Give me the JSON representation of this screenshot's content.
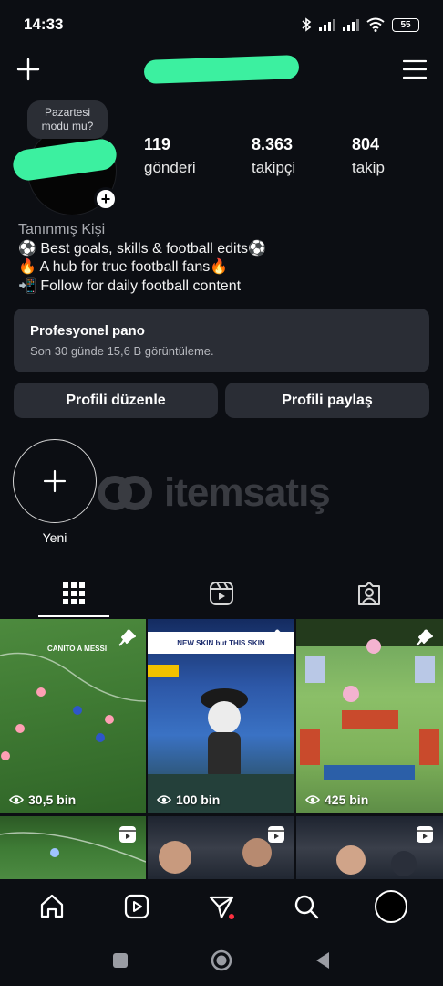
{
  "status_bar": {
    "time": "14:33",
    "battery": "55",
    "icons": [
      "bluetooth-icon",
      "signal-icon",
      "signal-icon",
      "wifi-icon",
      "battery-icon"
    ]
  },
  "header": {
    "left_icon": "plus-icon",
    "right_icon": "menu-icon"
  },
  "profile": {
    "note": "Pazartesi modu mu?",
    "stats": [
      {
        "value": "119",
        "label": "gönderi"
      },
      {
        "value": "8.363",
        "label": "takipçi"
      },
      {
        "value": "804",
        "label": "takip"
      }
    ]
  },
  "bio": {
    "category": "Tanınmış Kişi",
    "lines": [
      "⚽ Best goals, skills & football edits⚽",
      "🔥 A hub for true football fans🔥",
      "📲 Follow for daily football content"
    ]
  },
  "dashboard": {
    "title": "Profesyonel pano",
    "subtitle": "Son 30 günde 15,6 B görüntüleme."
  },
  "actions": {
    "edit": "Profili düzenle",
    "share": "Profili paylaş"
  },
  "highlight": {
    "label": "Yeni"
  },
  "watermark": {
    "text": "itemsatış"
  },
  "tabs": [
    "grid-icon",
    "reels-icon",
    "tagged-icon"
  ],
  "posts": [
    {
      "views": "30,5 bin",
      "badge": "pin-icon",
      "overlay": "CANITO A MESSI"
    },
    {
      "views": "100 bin",
      "badge": "pin-icon",
      "overlay": "NEW SKIN but THIS SKIN"
    },
    {
      "views": "425 bin",
      "badge": "pin-icon",
      "overlay": ""
    },
    {
      "views": "",
      "badge": "reel-icon",
      "overlay": ""
    },
    {
      "views": "",
      "badge": "reel-icon",
      "overlay": ""
    },
    {
      "views": "",
      "badge": "reel-icon",
      "overlay": ""
    }
  ],
  "bottom_nav": [
    "home-icon",
    "reels-icon",
    "send-icon",
    "search-icon",
    "profile-avatar"
  ],
  "android_nav": [
    "recents-icon",
    "home-icon",
    "back-icon"
  ]
}
